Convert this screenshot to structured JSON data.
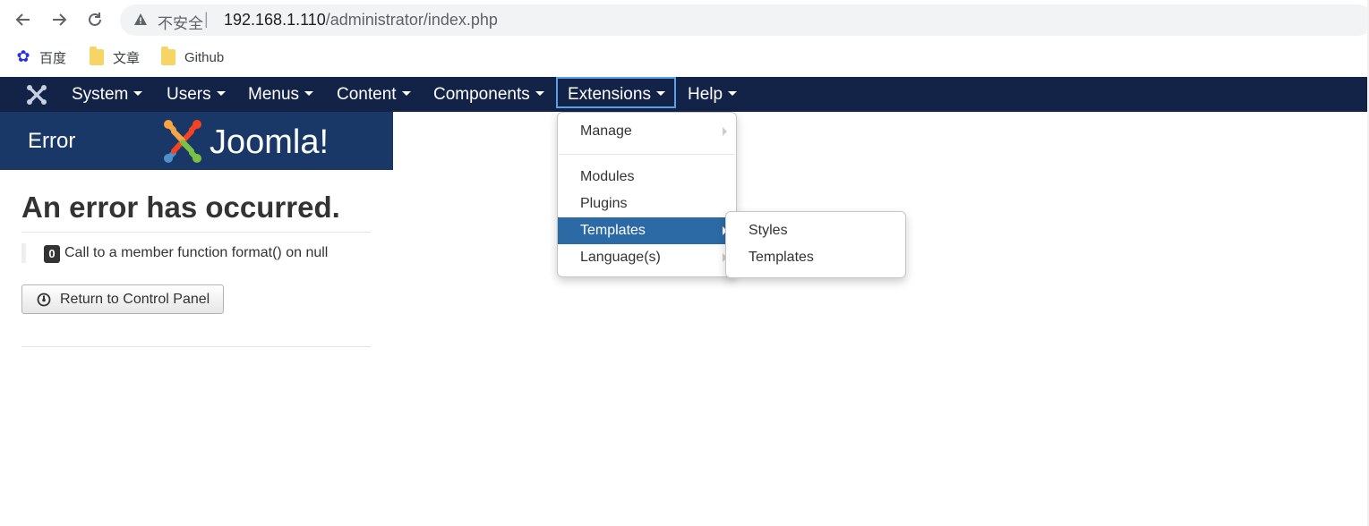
{
  "browser": {
    "back_icon": "arrow-left-icon",
    "forward_icon": "arrow-right-icon",
    "reload_icon": "reload-icon",
    "security_label": "不安全",
    "url_host": "192.168.1.110",
    "url_path": "/administrator/index.php"
  },
  "bookmarks": [
    {
      "label": "百度",
      "icon": "baidu-icon"
    },
    {
      "label": "文章",
      "icon": "folder-icon"
    },
    {
      "label": "Github",
      "icon": "folder-icon"
    }
  ],
  "navbar": {
    "items": [
      {
        "label": "System"
      },
      {
        "label": "Users"
      },
      {
        "label": "Menus"
      },
      {
        "label": "Content"
      },
      {
        "label": "Components"
      },
      {
        "label": "Extensions"
      },
      {
        "label": "Help"
      }
    ],
    "active_index": 5
  },
  "header": {
    "title": "Error",
    "logo_text": "Joomla!"
  },
  "error": {
    "heading": "An error has occurred.",
    "code": "0",
    "message": "Call to a member function format() on null",
    "return_button": "Return to Control Panel"
  },
  "extensions_menu": {
    "items": [
      {
        "label": "Manage",
        "has_submenu": true
      },
      {
        "label": "Modules"
      },
      {
        "label": "Plugins"
      },
      {
        "label": "Templates",
        "has_submenu": true,
        "highlighted": true
      },
      {
        "label": "Language(s)",
        "has_submenu": true
      }
    ]
  },
  "templates_submenu": {
    "items": [
      {
        "label": "Styles"
      },
      {
        "label": "Templates"
      }
    ]
  },
  "colors": {
    "navbar_bg": "#132347",
    "header_bg": "#1a3867",
    "menu_highlight": "#2c6aa6"
  }
}
